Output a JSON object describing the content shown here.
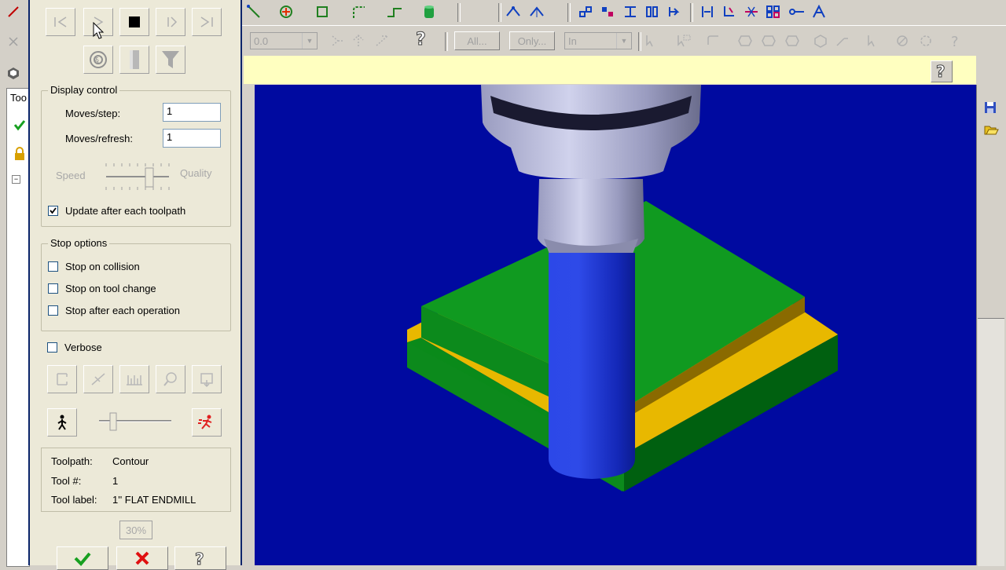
{
  "dialog": {
    "display_control": {
      "title": "Display control",
      "moves_per_step_label": "Moves/step:",
      "moves_per_step_value": "1",
      "moves_per_refresh_label": "Moves/refresh:",
      "moves_per_refresh_value": "1",
      "speed_label": "Speed",
      "quality_label": "Quality",
      "update_label": "Update after each toolpath",
      "update_checked": true
    },
    "stop_options": {
      "title": "Stop options",
      "collision_label": "Stop on collision",
      "tool_change_label": "Stop on tool change",
      "each_operation_label": "Stop after each operation"
    },
    "verbose_label": "Verbose",
    "info": {
      "toolpath_label": "Toolpath:",
      "toolpath_value": "Contour",
      "tool_num_label": "Tool #:",
      "tool_num_value": "1",
      "tool_label_label": "Tool label:",
      "tool_label_value": "1'' FLAT ENDMILL"
    },
    "progress_text": "30%"
  },
  "toolbar": {
    "combo_value": "0.0",
    "all_label": "All...",
    "only_label": "Only...",
    "units_value": "In"
  },
  "left_strip": {
    "tab_label": "Too"
  },
  "colors": {
    "viewport_bg": "#000aa0",
    "stock_green": "#0c8a1c",
    "stock_yellow": "#e8b800",
    "tool_blue": "#1a36d8",
    "holder_gray": "#a8aac8"
  }
}
